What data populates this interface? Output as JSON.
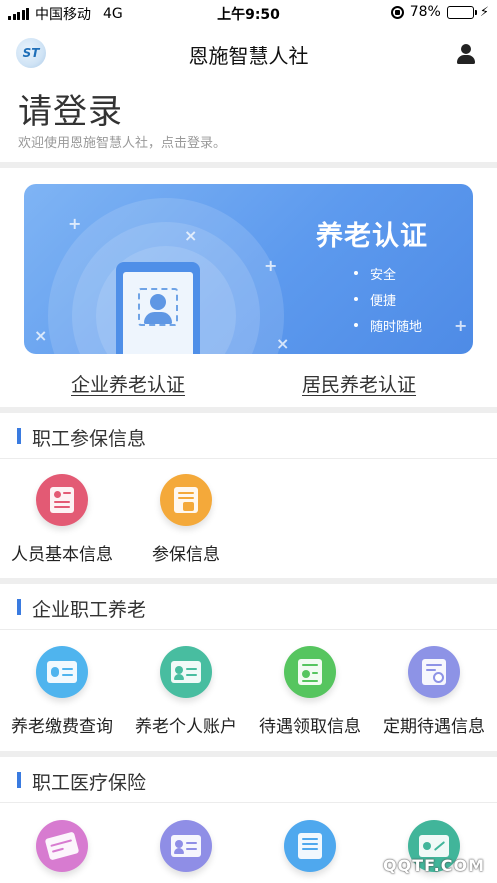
{
  "status_bar": {
    "carrier": "中国移动",
    "network": "4G",
    "time": "上午9:50",
    "battery": "78%",
    "battery_level": 0.78
  },
  "nav": {
    "title": "恩施智慧人社",
    "logo_text": "ST"
  },
  "login": {
    "title": "请登录",
    "subtitle": "欢迎使用恩施智慧人社，点击登录。"
  },
  "banner": {
    "title": "养老认证",
    "bullets": [
      "安全",
      "便捷",
      "随时随地"
    ]
  },
  "auth_links": {
    "enterprise": "企业养老认证",
    "resident": "居民养老认证"
  },
  "sections": [
    {
      "title": "职工参保信息",
      "items": [
        {
          "label": "人员基本信息",
          "icon": "id-card-icon",
          "color": "#e35a74"
        },
        {
          "label": "参保信息",
          "icon": "insurance-doc-icon",
          "color": "#f4a93a"
        }
      ]
    },
    {
      "title": "企业职工养老",
      "items": [
        {
          "label": "养老缴费查询",
          "icon": "payment-card-icon",
          "color": "#4fb4ee"
        },
        {
          "label": "养老个人账户",
          "icon": "account-card-icon",
          "color": "#48bda0"
        },
        {
          "label": "待遇领取信息",
          "icon": "benefit-doc-icon",
          "color": "#56c55f"
        },
        {
          "label": "定期待遇信息",
          "icon": "schedule-doc-icon",
          "color": "#8d93e6"
        }
      ]
    },
    {
      "title": "职工医疗保险",
      "items": [
        {
          "label": "",
          "icon": "medical-card-icon",
          "color": "#d77bd0"
        },
        {
          "label": "",
          "icon": "medical-id-icon",
          "color": "#8f8ee6"
        },
        {
          "label": "",
          "icon": "medical-payment-icon",
          "color": "#4fa8ee"
        },
        {
          "label": "",
          "icon": "medical-edit-icon",
          "color": "#41b59a"
        }
      ]
    }
  ],
  "watermark": "QQTF.COM"
}
